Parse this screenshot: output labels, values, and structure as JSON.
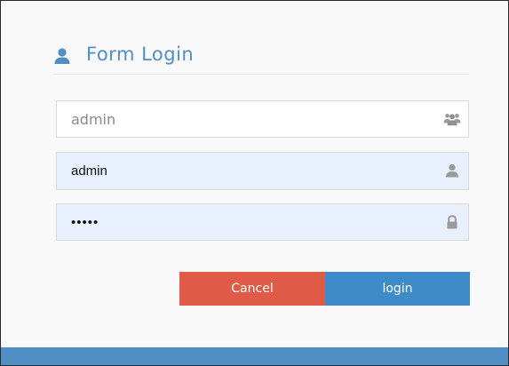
{
  "form": {
    "title": "Form Login",
    "title_icon": "user-icon",
    "group_field": {
      "value": "admin",
      "icon": "users-icon"
    },
    "username_field": {
      "value": "admin",
      "icon": "user-icon"
    },
    "password_field": {
      "value": "•••••",
      "icon": "lock-icon"
    },
    "cancel_label": "Cancel",
    "login_label": "login"
  },
  "colors": {
    "accent": "#4f8fc6",
    "cancel": "#e05b47",
    "login": "#3f8bc9",
    "autofill": "#e8f0fd"
  }
}
